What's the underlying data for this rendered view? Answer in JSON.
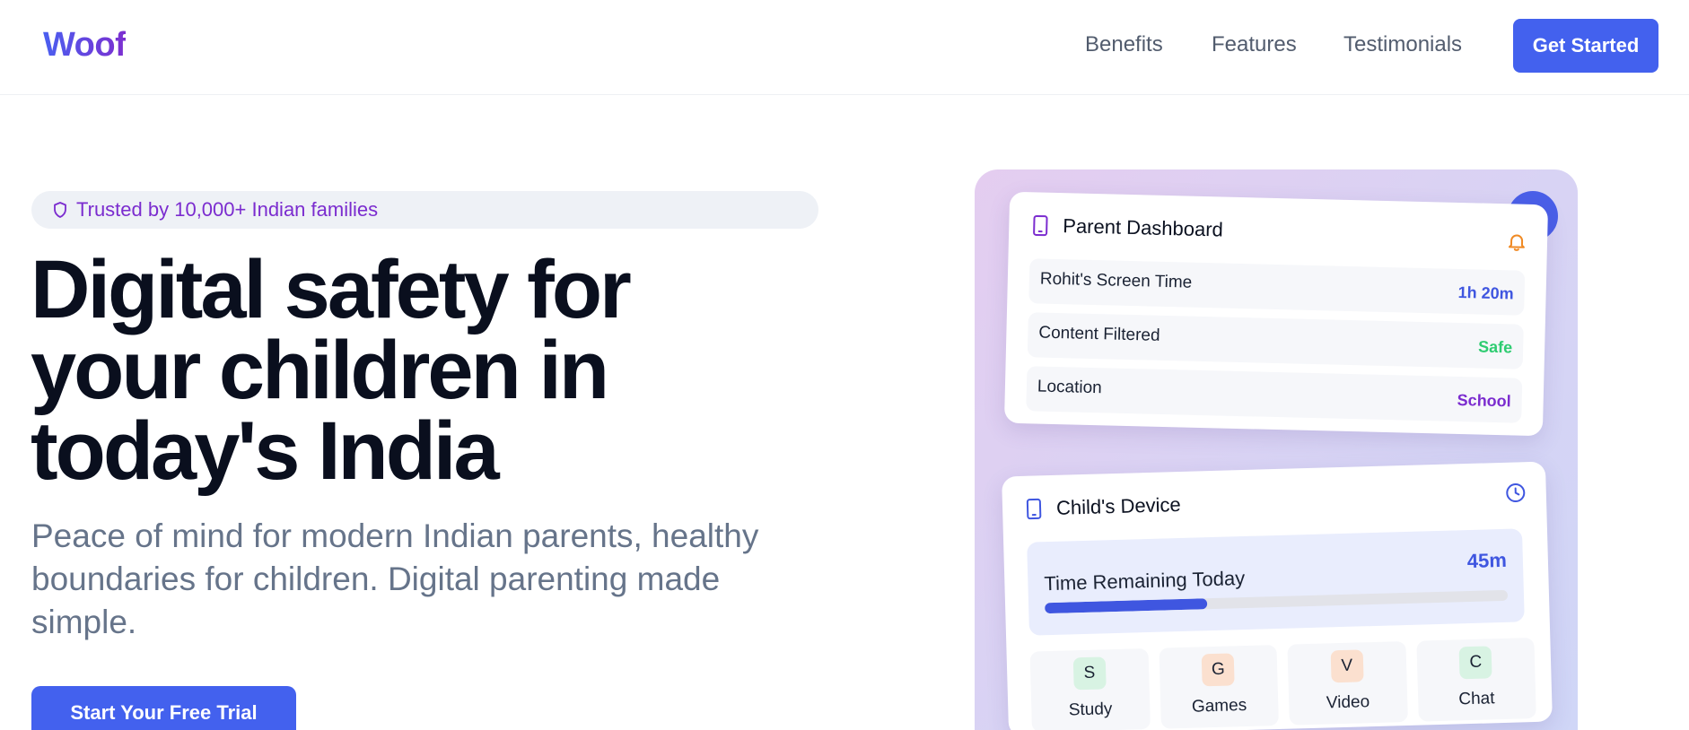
{
  "header": {
    "logo": "Woof",
    "nav": [
      "Benefits",
      "Features",
      "Testimonials"
    ],
    "cta": "Get Started"
  },
  "hero": {
    "badge": "Trusted by 10,000+ Indian families",
    "headline": [
      "Digital safety for",
      "your children in",
      "today's India"
    ],
    "subtitle": "Peace of mind for modern Indian parents, healthy boundaries for children. Digital parenting made simple.",
    "cta": "Start Your Free Trial"
  },
  "mockup": {
    "parent_card": {
      "title": "Parent Dashboard",
      "stats": [
        {
          "label": "Rohit's Screen Time",
          "value": "1h 20m",
          "color": "#3f56e0"
        },
        {
          "label": "Content Filtered",
          "value": "Safe",
          "color": "#2ecc71"
        },
        {
          "label": "Location",
          "value": "School",
          "color": "#7b2ccf"
        }
      ]
    },
    "child_card": {
      "title": "Child's Device",
      "time_label": "Time Remaining Today",
      "time_value": "45m",
      "progress": 0.35,
      "apps": [
        {
          "letter": "S",
          "name": "Study",
          "bg": "#d8f3e3"
        },
        {
          "letter": "G",
          "name": "Games",
          "bg": "#fbe0cf"
        },
        {
          "letter": "V",
          "name": "Video",
          "bg": "#fbe0cf"
        },
        {
          "letter": "C",
          "name": "Chat",
          "bg": "#d8f3e3"
        }
      ]
    }
  },
  "colors": {
    "primary": "#4361ee",
    "accent_purple": "#7b2ccf",
    "safe_green": "#2ecc71",
    "bell_orange": "#f08a24"
  },
  "icons": {
    "badge": "shield-icon",
    "parent_title": "phone-icon",
    "parent_action": "bell-icon",
    "child_title": "phone-icon",
    "child_action": "clock-icon",
    "floating": "shield-icon"
  }
}
